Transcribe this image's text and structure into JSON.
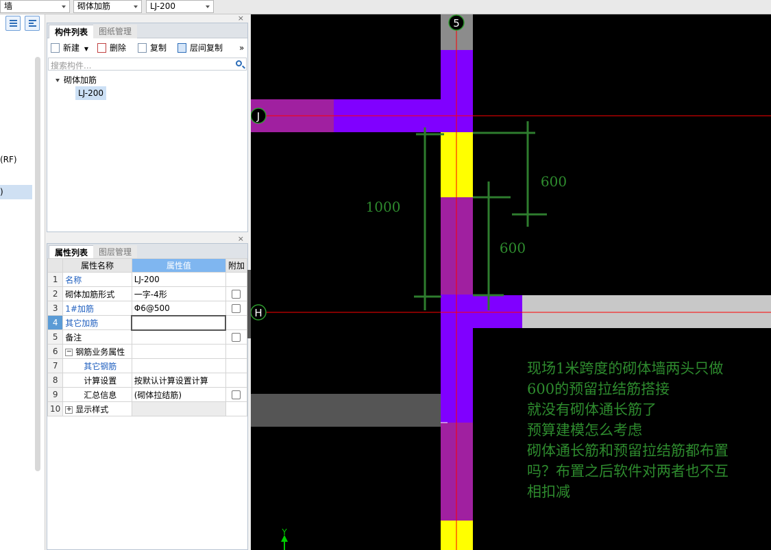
{
  "topbar": {
    "dropdown1": "墙",
    "dropdown2": "砌体加筋",
    "dropdown3": "LJ-200"
  },
  "leftnav": {
    "item_rf": "(RF)",
    "item_sel": ")"
  },
  "component_panel": {
    "tab_active": "构件列表",
    "tab_inactive": "图纸管理",
    "close": "×",
    "toolbar": {
      "new": "新建",
      "delete": "删除",
      "copy": "复制",
      "floor_copy": "层间复制",
      "more": "»"
    },
    "search_placeholder": "搜索构件...",
    "tree_root": "砌体加筋",
    "tree_child": "LJ-200"
  },
  "property_panel": {
    "tab_active": "属性列表",
    "tab_inactive": "图层管理",
    "close": "×",
    "col_name": "属性名称",
    "col_value": "属性值",
    "col_extra": "附加",
    "rows": [
      {
        "n": "1",
        "name": "名称",
        "value": "LJ-200"
      },
      {
        "n": "2",
        "name": "砌体加筋形式",
        "value": "一字-4形"
      },
      {
        "n": "3",
        "name": "1#加筋",
        "value": "Φ6@500"
      },
      {
        "n": "4",
        "name": "其它加筋",
        "value": ""
      },
      {
        "n": "5",
        "name": "备注",
        "value": ""
      },
      {
        "n": "6",
        "name": "钢筋业务属性",
        "value": ""
      },
      {
        "n": "7",
        "name": "其它钢筋",
        "value": ""
      },
      {
        "n": "8",
        "name": "计算设置",
        "value": "按默认计算设置计算"
      },
      {
        "n": "9",
        "name": "汇总信息",
        "value": "(砌体拉结筋)"
      },
      {
        "n": "10",
        "name": "显示样式",
        "value": ""
      }
    ]
  },
  "canvas": {
    "axis_5": "5",
    "axis_J": "J",
    "axis_H": "H",
    "dim_1000": "1000",
    "dim_600_a": "600",
    "dim_600_b": "600",
    "axis_y": "Y",
    "note_lines": [
      "现场1米跨度的砌体墙两头只做",
      "600的预留拉结筋搭接",
      "就没有砌体通长筋了",
      "预算建模怎么考虑",
      "砌体通长筋和预留拉结筋都布置",
      "吗？布置之后软件对两者也不互",
      "相扣减"
    ],
    "colors": {
      "wall_purple": "#8000ff",
      "wall_magenta": "#a020a0",
      "wall_yellow": "#ffff00",
      "wall_gray": "#c8c8c8",
      "dim_green": "#2e7d2e",
      "axis_red": "#ff0000"
    }
  }
}
